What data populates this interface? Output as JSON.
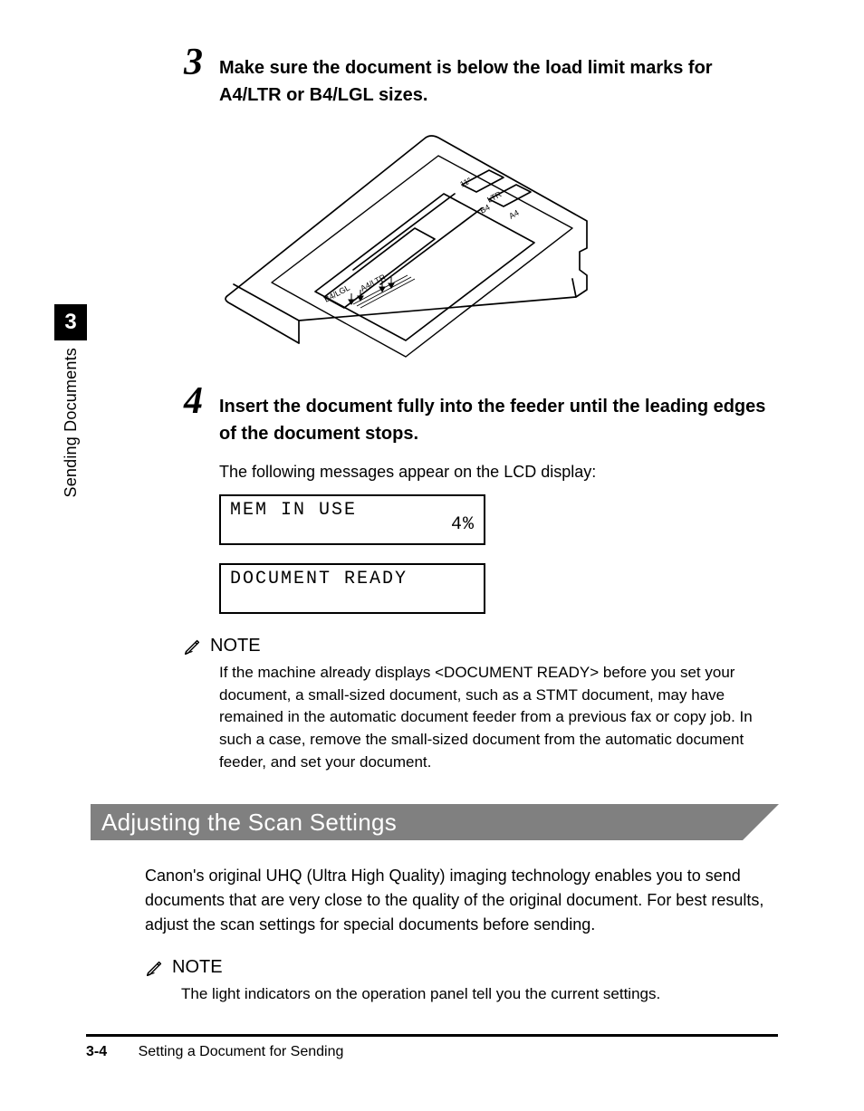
{
  "side": {
    "chapter": "3",
    "label": "Sending Documents"
  },
  "steps": {
    "s3": {
      "num": "3",
      "title": "Make sure the document is below the load limit marks for A4/LTR or B4/LGL sizes."
    },
    "s4": {
      "num": "4",
      "title": "Insert the document fully into the feeder until the leading edges of the document stops.",
      "followup": "The following messages appear on the LCD display:"
    }
  },
  "lcd1": {
    "line1": "MEM IN USE",
    "right": "4%"
  },
  "lcd2": {
    "line1": "DOCUMENT READY"
  },
  "note1": {
    "label": "NOTE",
    "body": "If the machine already displays <DOCUMENT READY> before you set your document, a small-sized document, such as a STMT document, may have remained in the automatic document feeder from a previous fax or copy job. In such a case, remove the small-sized document from the automatic document feeder, and set your document."
  },
  "section": {
    "title": "Adjusting the Scan Settings"
  },
  "sectionPara": "Canon's original UHQ (Ultra High Quality) imaging technology enables you to send documents that are very close to the quality of the original document. For best results, adjust the scan settings for special documents before sending.",
  "note2": {
    "label": "NOTE",
    "body": "The light indicators on the operation panel tell you the current settings."
  },
  "footer": {
    "page": "3-4",
    "title": "Setting a Document for Sending"
  },
  "illustrationLabels": {
    "top_11": "11\"",
    "top_ltr": "LTR",
    "top_b4": "B4",
    "top_a4": "A4",
    "tab_b4lgl": "B4/LGL",
    "tab_a4ltr": "A4/LTR"
  }
}
